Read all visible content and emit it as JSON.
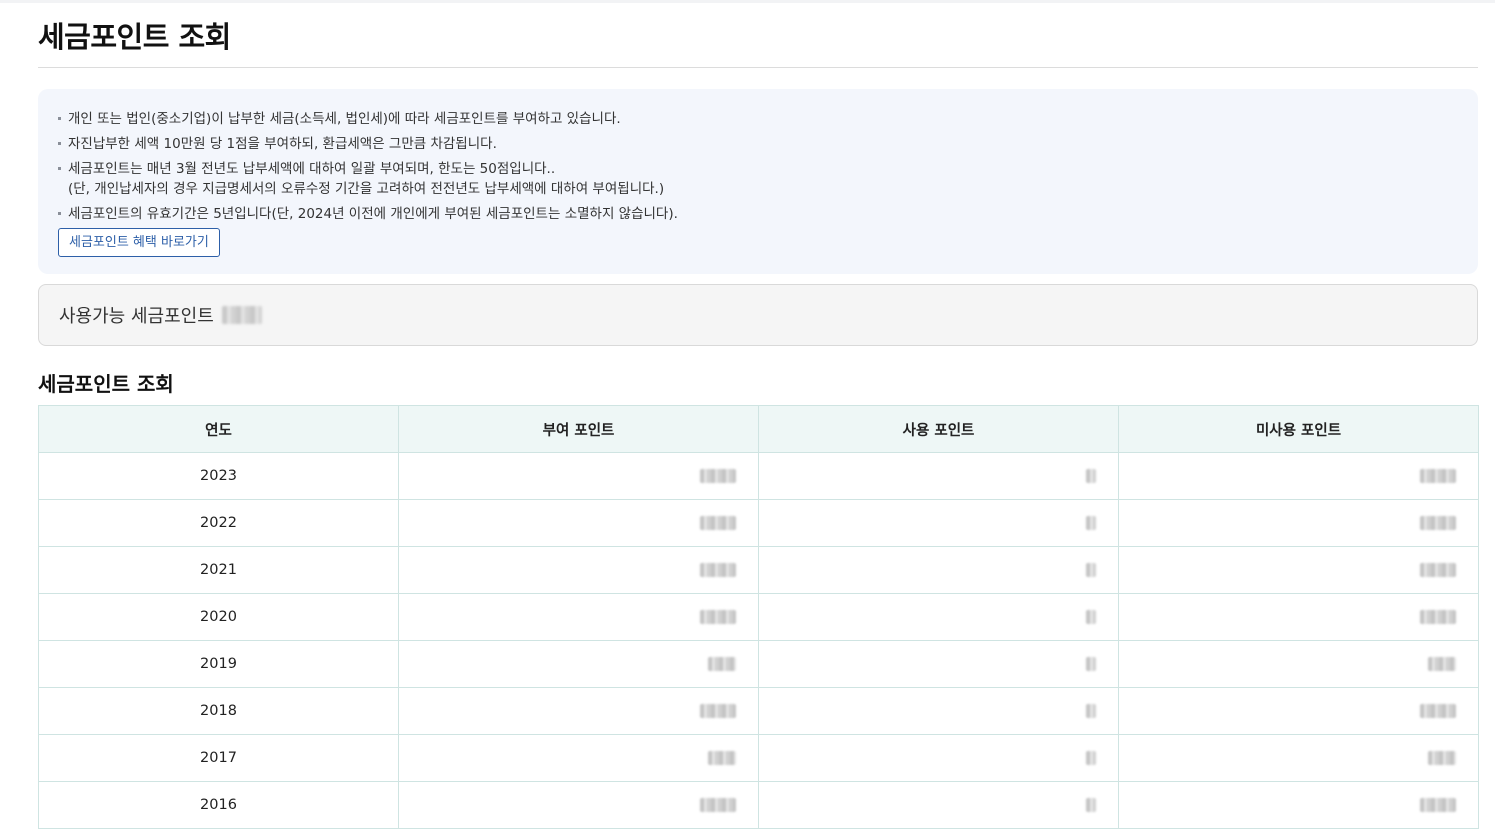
{
  "page": {
    "title": "세금포인트 조회"
  },
  "notice": {
    "items": [
      {
        "line1": "개인 또는 법인(중소기업)이 납부한 세금(소득세, 법인세)에 따라 세금포인트를 부여하고 있습니다.",
        "line2": ""
      },
      {
        "line1": "자진납부한 세액 10만원 당 1점을 부여하되, 환급세액은 그만큼 차감됩니다.",
        "line2": ""
      },
      {
        "line1": "세금포인트는 매년 3월 전년도 납부세액에 대하여 일괄 부여되며, 한도는 50점입니다..",
        "line2": "(단, 개인납세자의 경우 지급명세서의 오류수정 기간을 고려하여 전전년도 납부세액에 대하여 부여됩니다.)"
      },
      {
        "line1": "세금포인트의 유효기간은 5년입니다(단, 2024년 이전에 개인에게 부여된 세금포인트는 소멸하지 않습니다).",
        "line2": ""
      }
    ],
    "benefit_button": "세금포인트 혜택 바로가기"
  },
  "available": {
    "label": "사용가능 세금포인트"
  },
  "section": {
    "title": "세금포인트 조회"
  },
  "table": {
    "headers": [
      "연도",
      "부여 포인트",
      "사용 포인트",
      "미사용 포인트"
    ],
    "rows": [
      {
        "year": "2023"
      },
      {
        "year": "2022"
      },
      {
        "year": "2021"
      },
      {
        "year": "2020"
      },
      {
        "year": "2019"
      },
      {
        "year": "2018"
      },
      {
        "year": "2017"
      },
      {
        "year": "2016"
      }
    ]
  }
}
